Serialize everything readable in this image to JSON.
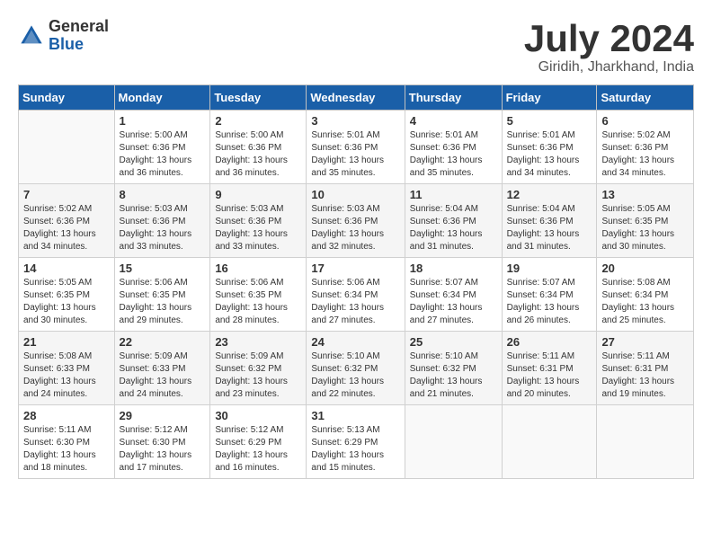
{
  "header": {
    "logo_general": "General",
    "logo_blue": "Blue",
    "month_title": "July 2024",
    "location": "Giridih, Jharkhand, India"
  },
  "days_of_week": [
    "Sunday",
    "Monday",
    "Tuesday",
    "Wednesday",
    "Thursday",
    "Friday",
    "Saturday"
  ],
  "weeks": [
    [
      {
        "day": "",
        "sunrise": "",
        "sunset": "",
        "daylight": ""
      },
      {
        "day": "1",
        "sunrise": "Sunrise: 5:00 AM",
        "sunset": "Sunset: 6:36 PM",
        "daylight": "Daylight: 13 hours and 36 minutes."
      },
      {
        "day": "2",
        "sunrise": "Sunrise: 5:00 AM",
        "sunset": "Sunset: 6:36 PM",
        "daylight": "Daylight: 13 hours and 36 minutes."
      },
      {
        "day": "3",
        "sunrise": "Sunrise: 5:01 AM",
        "sunset": "Sunset: 6:36 PM",
        "daylight": "Daylight: 13 hours and 35 minutes."
      },
      {
        "day": "4",
        "sunrise": "Sunrise: 5:01 AM",
        "sunset": "Sunset: 6:36 PM",
        "daylight": "Daylight: 13 hours and 35 minutes."
      },
      {
        "day": "5",
        "sunrise": "Sunrise: 5:01 AM",
        "sunset": "Sunset: 6:36 PM",
        "daylight": "Daylight: 13 hours and 34 minutes."
      },
      {
        "day": "6",
        "sunrise": "Sunrise: 5:02 AM",
        "sunset": "Sunset: 6:36 PM",
        "daylight": "Daylight: 13 hours and 34 minutes."
      }
    ],
    [
      {
        "day": "7",
        "sunrise": "Sunrise: 5:02 AM",
        "sunset": "Sunset: 6:36 PM",
        "daylight": "Daylight: 13 hours and 34 minutes."
      },
      {
        "day": "8",
        "sunrise": "Sunrise: 5:03 AM",
        "sunset": "Sunset: 6:36 PM",
        "daylight": "Daylight: 13 hours and 33 minutes."
      },
      {
        "day": "9",
        "sunrise": "Sunrise: 5:03 AM",
        "sunset": "Sunset: 6:36 PM",
        "daylight": "Daylight: 13 hours and 33 minutes."
      },
      {
        "day": "10",
        "sunrise": "Sunrise: 5:03 AM",
        "sunset": "Sunset: 6:36 PM",
        "daylight": "Daylight: 13 hours and 32 minutes."
      },
      {
        "day": "11",
        "sunrise": "Sunrise: 5:04 AM",
        "sunset": "Sunset: 6:36 PM",
        "daylight": "Daylight: 13 hours and 31 minutes."
      },
      {
        "day": "12",
        "sunrise": "Sunrise: 5:04 AM",
        "sunset": "Sunset: 6:36 PM",
        "daylight": "Daylight: 13 hours and 31 minutes."
      },
      {
        "day": "13",
        "sunrise": "Sunrise: 5:05 AM",
        "sunset": "Sunset: 6:35 PM",
        "daylight": "Daylight: 13 hours and 30 minutes."
      }
    ],
    [
      {
        "day": "14",
        "sunrise": "Sunrise: 5:05 AM",
        "sunset": "Sunset: 6:35 PM",
        "daylight": "Daylight: 13 hours and 30 minutes."
      },
      {
        "day": "15",
        "sunrise": "Sunrise: 5:06 AM",
        "sunset": "Sunset: 6:35 PM",
        "daylight": "Daylight: 13 hours and 29 minutes."
      },
      {
        "day": "16",
        "sunrise": "Sunrise: 5:06 AM",
        "sunset": "Sunset: 6:35 PM",
        "daylight": "Daylight: 13 hours and 28 minutes."
      },
      {
        "day": "17",
        "sunrise": "Sunrise: 5:06 AM",
        "sunset": "Sunset: 6:34 PM",
        "daylight": "Daylight: 13 hours and 27 minutes."
      },
      {
        "day": "18",
        "sunrise": "Sunrise: 5:07 AM",
        "sunset": "Sunset: 6:34 PM",
        "daylight": "Daylight: 13 hours and 27 minutes."
      },
      {
        "day": "19",
        "sunrise": "Sunrise: 5:07 AM",
        "sunset": "Sunset: 6:34 PM",
        "daylight": "Daylight: 13 hours and 26 minutes."
      },
      {
        "day": "20",
        "sunrise": "Sunrise: 5:08 AM",
        "sunset": "Sunset: 6:34 PM",
        "daylight": "Daylight: 13 hours and 25 minutes."
      }
    ],
    [
      {
        "day": "21",
        "sunrise": "Sunrise: 5:08 AM",
        "sunset": "Sunset: 6:33 PM",
        "daylight": "Daylight: 13 hours and 24 minutes."
      },
      {
        "day": "22",
        "sunrise": "Sunrise: 5:09 AM",
        "sunset": "Sunset: 6:33 PM",
        "daylight": "Daylight: 13 hours and 24 minutes."
      },
      {
        "day": "23",
        "sunrise": "Sunrise: 5:09 AM",
        "sunset": "Sunset: 6:32 PM",
        "daylight": "Daylight: 13 hours and 23 minutes."
      },
      {
        "day": "24",
        "sunrise": "Sunrise: 5:10 AM",
        "sunset": "Sunset: 6:32 PM",
        "daylight": "Daylight: 13 hours and 22 minutes."
      },
      {
        "day": "25",
        "sunrise": "Sunrise: 5:10 AM",
        "sunset": "Sunset: 6:32 PM",
        "daylight": "Daylight: 13 hours and 21 minutes."
      },
      {
        "day": "26",
        "sunrise": "Sunrise: 5:11 AM",
        "sunset": "Sunset: 6:31 PM",
        "daylight": "Daylight: 13 hours and 20 minutes."
      },
      {
        "day": "27",
        "sunrise": "Sunrise: 5:11 AM",
        "sunset": "Sunset: 6:31 PM",
        "daylight": "Daylight: 13 hours and 19 minutes."
      }
    ],
    [
      {
        "day": "28",
        "sunrise": "Sunrise: 5:11 AM",
        "sunset": "Sunset: 6:30 PM",
        "daylight": "Daylight: 13 hours and 18 minutes."
      },
      {
        "day": "29",
        "sunrise": "Sunrise: 5:12 AM",
        "sunset": "Sunset: 6:30 PM",
        "daylight": "Daylight: 13 hours and 17 minutes."
      },
      {
        "day": "30",
        "sunrise": "Sunrise: 5:12 AM",
        "sunset": "Sunset: 6:29 PM",
        "daylight": "Daylight: 13 hours and 16 minutes."
      },
      {
        "day": "31",
        "sunrise": "Sunrise: 5:13 AM",
        "sunset": "Sunset: 6:29 PM",
        "daylight": "Daylight: 13 hours and 15 minutes."
      },
      {
        "day": "",
        "sunrise": "",
        "sunset": "",
        "daylight": ""
      },
      {
        "day": "",
        "sunrise": "",
        "sunset": "",
        "daylight": ""
      },
      {
        "day": "",
        "sunrise": "",
        "sunset": "",
        "daylight": ""
      }
    ]
  ]
}
